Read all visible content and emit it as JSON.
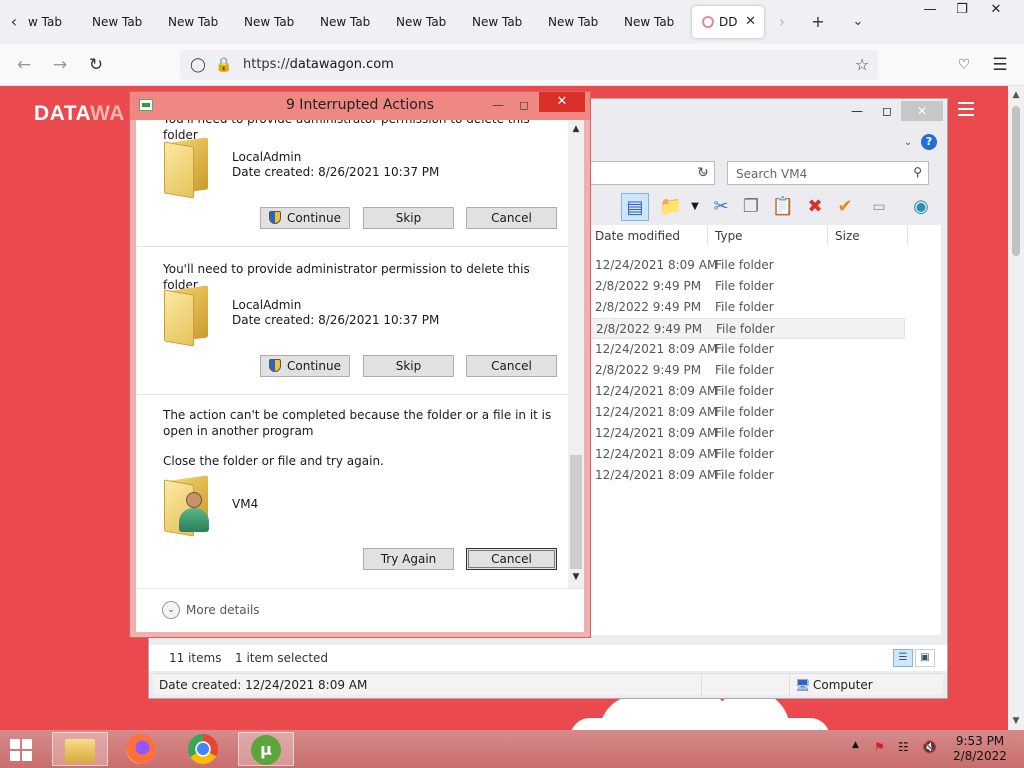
{
  "browser": {
    "tabs": [
      "w Tab",
      "New Tab",
      "New Tab",
      "New Tab",
      "New Tab",
      "New Tab",
      "New Tab",
      "New Tab",
      "New Tab"
    ],
    "active_tab": "DD",
    "url_prefix": "https://",
    "url_host": "datawagon.com"
  },
  "site": {
    "logo_main": "DATA",
    "logo_dim": "WA"
  },
  "explorer": {
    "search_placeholder": "Search VM4",
    "help_label": "?",
    "columns": [
      "Date modified",
      "Type",
      "Size"
    ],
    "rows": [
      {
        "date": "12/24/2021 8:09 AM",
        "type": "File folder"
      },
      {
        "date": "2/8/2022 9:49 PM",
        "type": "File folder"
      },
      {
        "date": "2/8/2022 9:49 PM",
        "type": "File folder"
      },
      {
        "date": "2/8/2022 9:49 PM",
        "type": "File folder"
      },
      {
        "date": "12/24/2021 8:09 AM",
        "type": "File folder"
      },
      {
        "date": "2/8/2022 9:49 PM",
        "type": "File folder"
      },
      {
        "date": "12/24/2021 8:09 AM",
        "type": "File folder"
      },
      {
        "date": "12/24/2021 8:09 AM",
        "type": "File folder"
      },
      {
        "date": "12/24/2021 8:09 AM",
        "type": "File folder"
      },
      {
        "date": "12/24/2021 8:09 AM",
        "type": "File folder"
      },
      {
        "date": "12/24/2021 8:09 AM",
        "type": "File folder"
      }
    ],
    "item_count": "11 items",
    "selection": "1 item selected",
    "detail_date": "Date created: 12/24/2021 8:09 AM",
    "location": "Computer"
  },
  "dialog": {
    "title": "9 Interrupted Actions",
    "cut_text": "You'll need to provide administrator permission to delete this folder",
    "items": [
      {
        "message": "You'll need to provide administrator permission to delete this folder",
        "name": "LocalAdmin",
        "date": "Date created: 8/26/2021 10:37 PM",
        "continue": "Continue",
        "skip": "Skip",
        "cancel": "Cancel"
      },
      {
        "message": "You'll need to provide administrator permission to delete this folder",
        "name": "LocalAdmin",
        "date": "Date created: 8/26/2021 10:37 PM",
        "continue": "Continue",
        "skip": "Skip",
        "cancel": "Cancel"
      }
    ],
    "error": {
      "message": "The action can't be completed because the folder or a file in it is open in another program",
      "hint": "Close the folder or file and try again.",
      "name": "VM4",
      "try_again": "Try Again",
      "cancel": "Cancel"
    },
    "more_details": "More details"
  },
  "taskbar": {
    "time": "9:53 PM",
    "date": "2/8/2022"
  },
  "colors": {
    "page_red": "#ea4a4d",
    "dialog_title": "#ef8783",
    "dialog_close": "#d9302a",
    "taskbar": "#c96e6e"
  }
}
